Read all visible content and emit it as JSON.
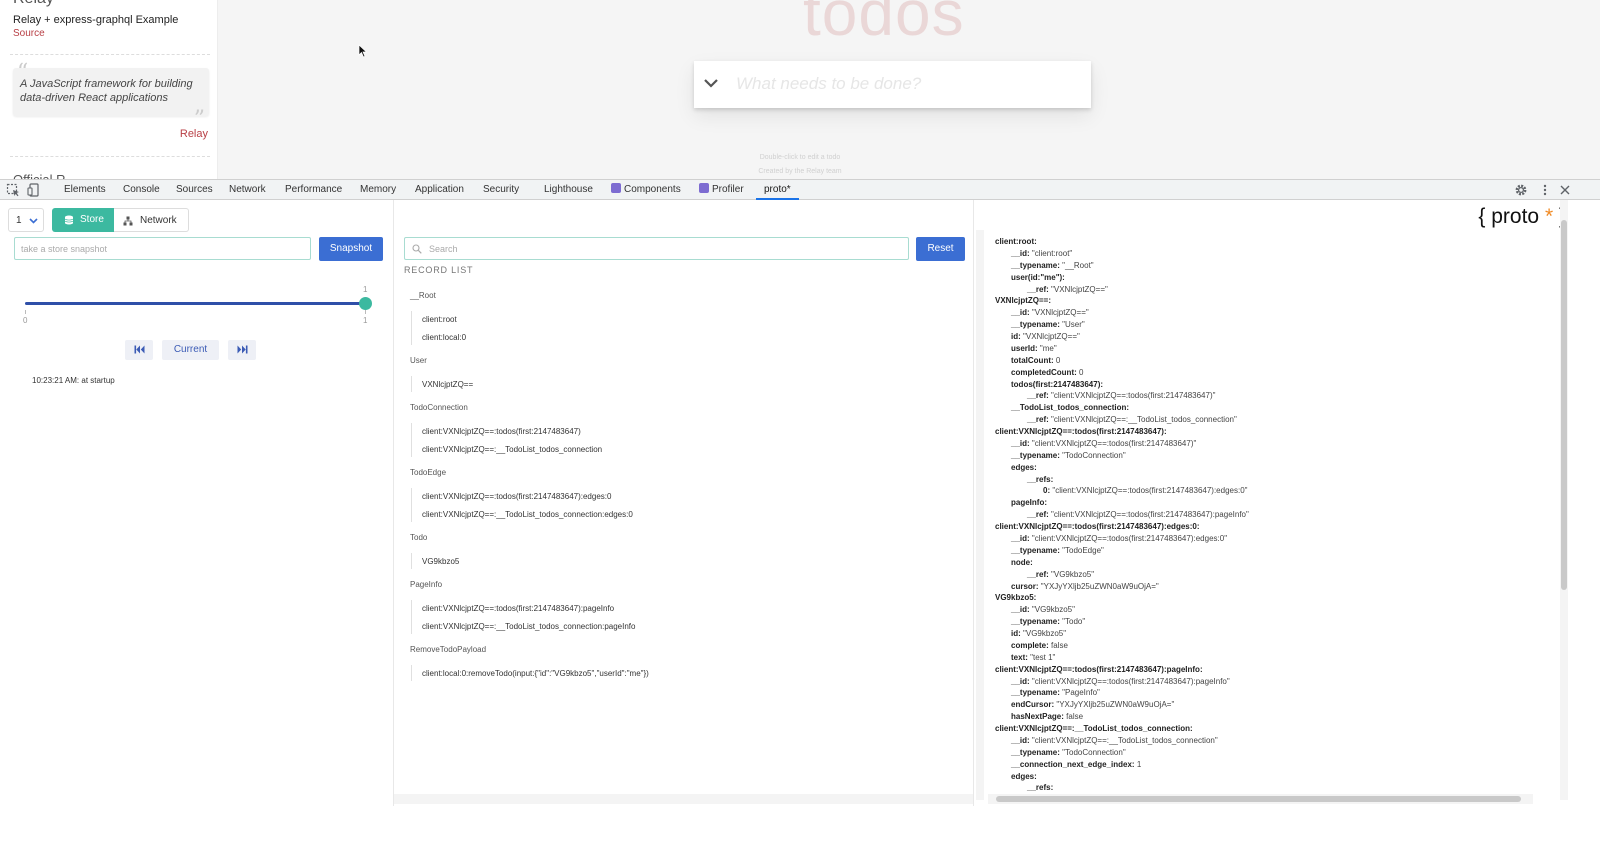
{
  "webpage": {
    "relay_heading": "Relay",
    "example_title": "Relay + express-graphql Example",
    "source_link": "Source",
    "quote_text": "A JavaScript framework for building data-driven React applications",
    "quote_author": "Relay",
    "official_text": "Official R",
    "todos_title": "todos",
    "todo_placeholder": "What needs to be done?",
    "footer_hint": "Double-click to edit a todo",
    "footer_credit": "Created by the Relay team"
  },
  "devtools": {
    "tabs": [
      {
        "label": "Elements"
      },
      {
        "label": "Console"
      },
      {
        "label": "Sources"
      },
      {
        "label": "Network"
      },
      {
        "label": "Performance"
      },
      {
        "label": "Memory"
      },
      {
        "label": "Application"
      },
      {
        "label": "Security"
      },
      {
        "label": "Lighthouse"
      },
      {
        "label": "Components"
      },
      {
        "label": "Profiler"
      },
      {
        "label": "proto*"
      }
    ],
    "active_tab": "proto*"
  },
  "left_pane": {
    "environment_value": "1",
    "store_label": "Store",
    "network_label": "Network",
    "snapshot_placeholder": "take a store snapshot",
    "snapshot_button": "Snapshot",
    "slider_min": "0",
    "slider_max": "1",
    "slider_value_label": "1",
    "slider_max_label": "1",
    "slider_value": 1,
    "current_button": "Current",
    "history": "10:23:21 AM: at startup"
  },
  "mid_pane": {
    "search_placeholder": "Search",
    "reset_button": "Reset",
    "record_list_title": "RECORD LIST",
    "groups": [
      {
        "type": "__Root",
        "items": [
          "client:root",
          "client:local:0"
        ]
      },
      {
        "type": "User",
        "items": [
          "VXNlcjptZQ=="
        ]
      },
      {
        "type": "TodoConnection",
        "items": [
          "client:VXNlcjptZQ==:todos(first:2147483647)",
          "client:VXNlcjptZQ==:__TodoList_todos_connection"
        ]
      },
      {
        "type": "TodoEdge",
        "items": [
          "client:VXNlcjptZQ==:todos(first:2147483647):edges:0",
          "client:VXNlcjptZQ==:__TodoList_todos_connection:edges:0"
        ]
      },
      {
        "type": "Todo",
        "items": [
          "VG9kbzo5"
        ]
      },
      {
        "type": "PageInfo",
        "items": [
          "client:VXNlcjptZQ==:todos(first:2147483647):pageInfo",
          "client:VXNlcjptZQ==:__TodoList_todos_connection:pageInfo"
        ]
      },
      {
        "type": "RemoveTodoPayload",
        "items": [
          "client:local:0:removeTodo(input:{\"id\":\"VG9kbzo5\",\"userId\":\"me\"})"
        ]
      }
    ]
  },
  "right_pane": {
    "logo_text": "{ proto ",
    "logo_star": "*",
    "logo_close": " }",
    "store_lines": [
      {
        "indent": 0,
        "key": "client:root:",
        "value": ""
      },
      {
        "indent": 1,
        "key": "__id:",
        "value": "\"client:root\""
      },
      {
        "indent": 1,
        "key": "__typename:",
        "value": "\"__Root\""
      },
      {
        "indent": 1,
        "key": "user(id:\"me\"):",
        "value": ""
      },
      {
        "indent": 2,
        "key": "__ref:",
        "value": "\"VXNlcjptZQ==\""
      },
      {
        "indent": 0,
        "key": "VXNlcjptZQ==:",
        "value": ""
      },
      {
        "indent": 1,
        "key": "__id:",
        "value": "\"VXNlcjptZQ==\""
      },
      {
        "indent": 1,
        "key": "__typename:",
        "value": "\"User\""
      },
      {
        "indent": 1,
        "key": "id:",
        "value": "\"VXNlcjptZQ==\""
      },
      {
        "indent": 1,
        "key": "userId:",
        "value": "\"me\""
      },
      {
        "indent": 1,
        "key": "totalCount:",
        "value": "0"
      },
      {
        "indent": 1,
        "key": "completedCount:",
        "value": "0"
      },
      {
        "indent": 1,
        "key": "todos(first:2147483647):",
        "value": ""
      },
      {
        "indent": 2,
        "key": "__ref:",
        "value": "\"client:VXNlcjptZQ==:todos(first:2147483647)\""
      },
      {
        "indent": 1,
        "key": "__TodoList_todos_connection:",
        "value": ""
      },
      {
        "indent": 2,
        "key": "__ref:",
        "value": "\"client:VXNlcjptZQ==:__TodoList_todos_connection\""
      },
      {
        "indent": 0,
        "key": "client:VXNlcjptZQ==:todos(first:2147483647):",
        "value": ""
      },
      {
        "indent": 1,
        "key": "__id:",
        "value": "\"client:VXNlcjptZQ==:todos(first:2147483647)\""
      },
      {
        "indent": 1,
        "key": "__typename:",
        "value": "\"TodoConnection\""
      },
      {
        "indent": 1,
        "key": "edges:",
        "value": ""
      },
      {
        "indent": 2,
        "key": "__refs:",
        "value": ""
      },
      {
        "indent": 3,
        "key": "0:",
        "value": "\"client:VXNlcjptZQ==:todos(first:2147483647):edges:0\""
      },
      {
        "indent": 1,
        "key": "pageInfo:",
        "value": ""
      },
      {
        "indent": 2,
        "key": "__ref:",
        "value": "\"client:VXNlcjptZQ==:todos(first:2147483647):pageInfo\""
      },
      {
        "indent": 0,
        "key": "client:VXNlcjptZQ==:todos(first:2147483647):edges:0:",
        "value": ""
      },
      {
        "indent": 1,
        "key": "__id:",
        "value": "\"client:VXNlcjptZQ==:todos(first:2147483647):edges:0\""
      },
      {
        "indent": 1,
        "key": "__typename:",
        "value": "\"TodoEdge\""
      },
      {
        "indent": 1,
        "key": "node:",
        "value": ""
      },
      {
        "indent": 2,
        "key": "__ref:",
        "value": "\"VG9kbzo5\""
      },
      {
        "indent": 1,
        "key": "cursor:",
        "value": "\"YXJyYXljb25uZWN0aW9uOjA=\""
      },
      {
        "indent": 0,
        "key": "VG9kbzo5:",
        "value": ""
      },
      {
        "indent": 1,
        "key": "__id:",
        "value": "\"VG9kbzo5\""
      },
      {
        "indent": 1,
        "key": "__typename:",
        "value": "\"Todo\""
      },
      {
        "indent": 1,
        "key": "id:",
        "value": "\"VG9kbzo5\""
      },
      {
        "indent": 1,
        "key": "complete:",
        "value": "false"
      },
      {
        "indent": 1,
        "key": "text:",
        "value": "\"test 1\""
      },
      {
        "indent": 0,
        "key": "client:VXNlcjptZQ==:todos(first:2147483647):pageInfo:",
        "value": ""
      },
      {
        "indent": 1,
        "key": "__id:",
        "value": "\"client:VXNlcjptZQ==:todos(first:2147483647):pageInfo\""
      },
      {
        "indent": 1,
        "key": "__typename:",
        "value": "\"PageInfo\""
      },
      {
        "indent": 1,
        "key": "endCursor:",
        "value": "\"YXJyYXljb25uZWN0aW9uOjA=\""
      },
      {
        "indent": 1,
        "key": "hasNextPage:",
        "value": "false"
      },
      {
        "indent": 0,
        "key": "client:VXNlcjptZQ==:__TodoList_todos_connection:",
        "value": ""
      },
      {
        "indent": 1,
        "key": "__id:",
        "value": "\"client:VXNlcjptZQ==:__TodoList_todos_connection\""
      },
      {
        "indent": 1,
        "key": "__typename:",
        "value": "\"TodoConnection\""
      },
      {
        "indent": 1,
        "key": "__connection_next_edge_index:",
        "value": "1"
      },
      {
        "indent": 1,
        "key": "edges:",
        "value": ""
      },
      {
        "indent": 2,
        "key": "__refs:",
        "value": ""
      }
    ]
  }
}
